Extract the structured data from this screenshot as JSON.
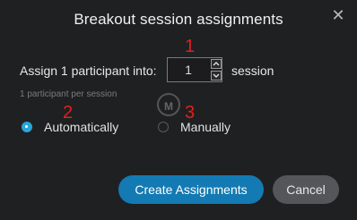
{
  "dialog": {
    "title": "Breakout session assignments",
    "close_icon": "close-icon"
  },
  "assign": {
    "prefix": "Assign 1 participant into:",
    "count_value": "1",
    "suffix": "session",
    "hint": "1 participant per session"
  },
  "options": [
    {
      "label": "Automatically",
      "checked": true
    },
    {
      "label": "Manually",
      "checked": false
    }
  ],
  "annotations": [
    "1",
    "2",
    "3"
  ],
  "watermark": "M",
  "buttons": {
    "create": "Create Assignments",
    "cancel": "Cancel"
  },
  "colors": {
    "primary": "#137ab3",
    "radio_checked": "#2aa4d8",
    "annotation": "#e02020",
    "background": "#1f2022"
  }
}
